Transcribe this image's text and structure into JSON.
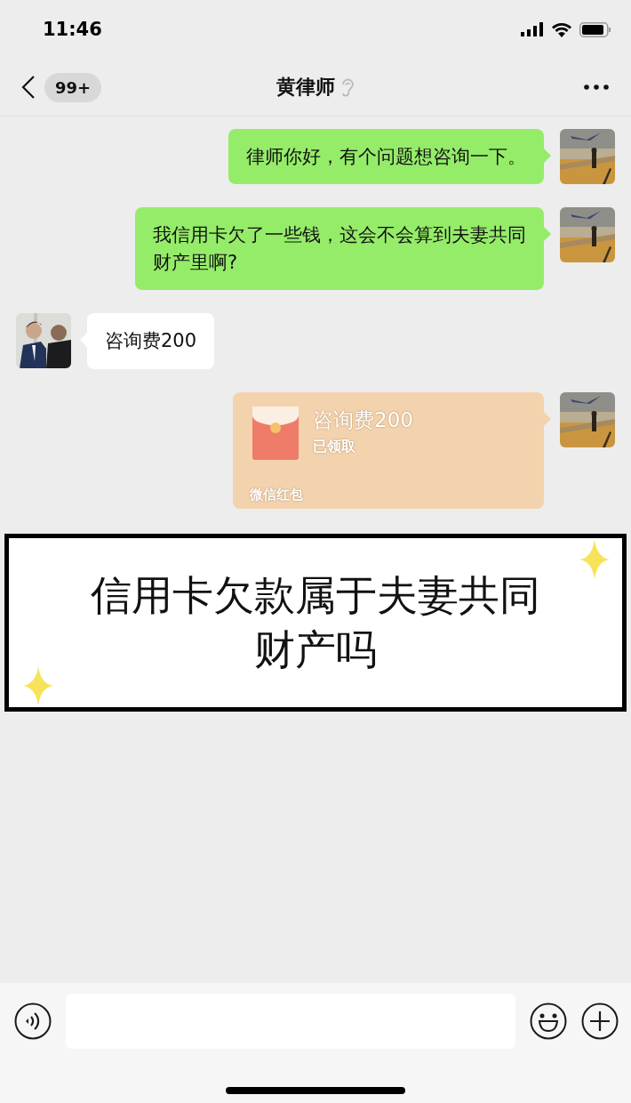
{
  "status_bar": {
    "time": "11:46"
  },
  "nav": {
    "unread_badge": "99+",
    "title": "黄律师",
    "earpiece_mode": true
  },
  "messages": [
    {
      "kind": "text",
      "outgoing": true,
      "text": "律师你好，有个问题想咨询一下。"
    },
    {
      "kind": "text",
      "outgoing": true,
      "text": "我信用卡欠了一些钱，这会不会算到夫妻共同财产里啊?"
    },
    {
      "kind": "text",
      "outgoing": false,
      "text": "咨询费200"
    },
    {
      "kind": "red_packet",
      "outgoing": true,
      "title": "咨询费200",
      "status": "已领取",
      "footer": "微信红包"
    }
  ],
  "caption": {
    "text": "信用卡欠款属于夫妻共同财产吗"
  }
}
